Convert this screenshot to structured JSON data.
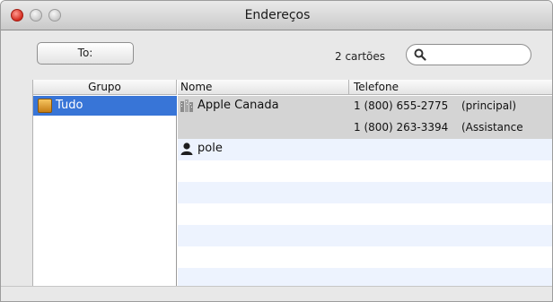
{
  "window": {
    "title": "Endereços"
  },
  "toolbar": {
    "to_label": "To:",
    "count_text": "2 cartões",
    "search_value": "",
    "search_placeholder": ""
  },
  "columns": {
    "group": "Grupo",
    "name": "Nome",
    "phone": "Telefone"
  },
  "groups": [
    {
      "label": "Tudo",
      "icon": "address-book-group-icon",
      "selected": true
    }
  ],
  "contacts": [
    {
      "name": "Apple Canada",
      "icon": "company-icon",
      "phones": [
        {
          "number": "1 (800) 655-2775",
          "label": "(principal)"
        },
        {
          "number": "1 (800) 263-3394",
          "label": "(Assistance"
        }
      ],
      "selected": true
    },
    {
      "name": "pole",
      "icon": "person-icon",
      "phones": [],
      "selected": false
    }
  ],
  "colors": {
    "selection": "#3875d7",
    "row_highlight": "#d4d4d4",
    "stripe": "#edf3fe"
  }
}
